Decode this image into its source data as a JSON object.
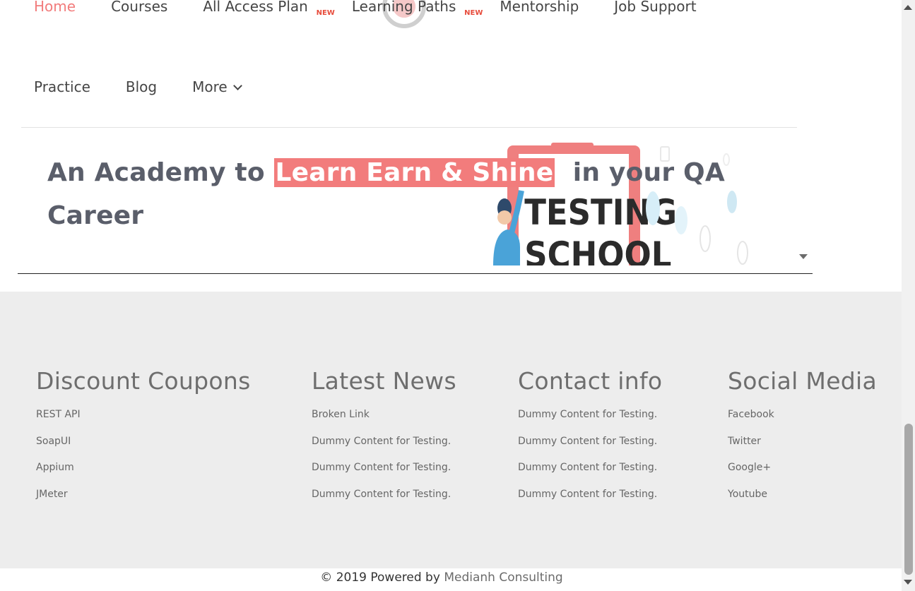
{
  "nav": {
    "row1": [
      {
        "label": "Home",
        "active": true,
        "new": false
      },
      {
        "label": "Courses",
        "active": false,
        "new": false
      },
      {
        "label": "All Access Plan",
        "active": false,
        "new": true
      },
      {
        "label": "Learning Paths",
        "active": false,
        "new": true
      },
      {
        "label": "Mentorship",
        "active": false,
        "new": false
      },
      {
        "label": "Job Support",
        "active": false,
        "new": false
      }
    ],
    "row2": [
      {
        "label": "Practice"
      },
      {
        "label": "Blog"
      },
      {
        "label": "More"
      }
    ],
    "new_badge": "NEW"
  },
  "hero": {
    "title_before": "An Academy to ",
    "title_highlight": "Learn Earn & Shine",
    "title_after": "  in your QA Career",
    "art_text_1": "TESTING",
    "art_text_2": "SCHOOL"
  },
  "footer": {
    "columns": [
      {
        "heading": "Discount Coupons",
        "links": [
          "REST API",
          "SoapUI",
          "Appium",
          "JMeter"
        ]
      },
      {
        "heading": "Latest News",
        "links": [
          "Broken Link",
          "Dummy Content for Testing.",
          "Dummy Content for Testing.",
          "Dummy Content for Testing."
        ]
      },
      {
        "heading": "Contact info",
        "links": [
          "Dummy Content for Testing.",
          "Dummy Content for Testing.",
          "Dummy Content for Testing.",
          "Dummy Content for Testing."
        ]
      },
      {
        "heading": "Social Media",
        "links": [
          "Facebook",
          "Twitter",
          "Google+",
          "Youtube"
        ]
      }
    ]
  },
  "copyright": {
    "prefix": "© 2019 Powered by ",
    "brand": "Medianh Consulting"
  },
  "colors": {
    "accent": "#f27c7c",
    "footer_bg": "#ededed",
    "heading": "#5a5e6a"
  }
}
